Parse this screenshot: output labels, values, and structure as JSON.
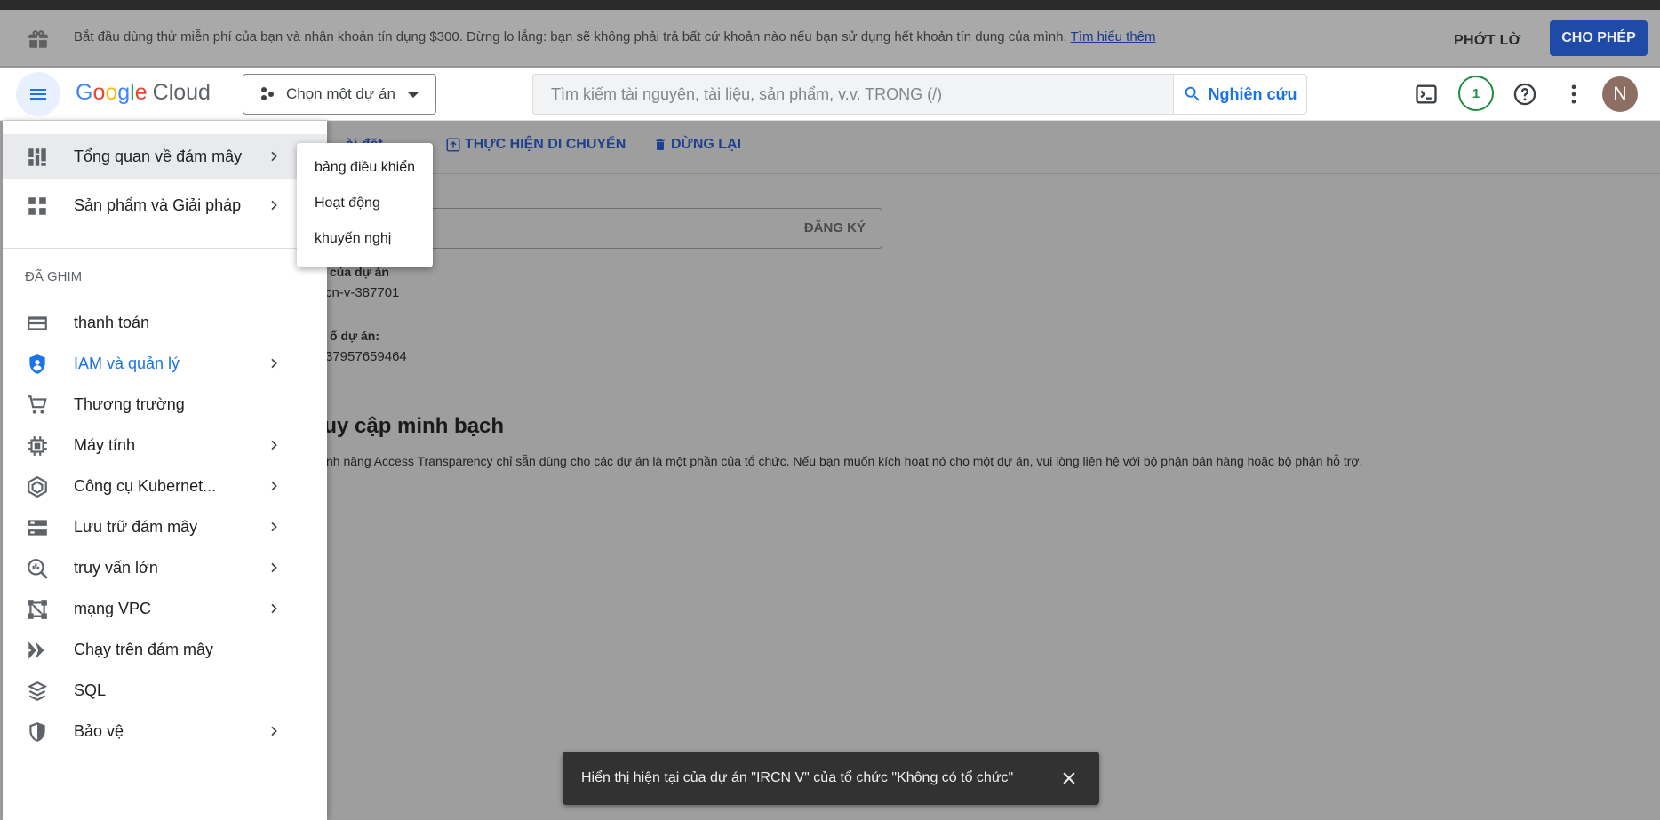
{
  "banner": {
    "message": "Bắt đầu dùng thử miễn phí của bạn và nhận khoản tín dụng $300. Đừng lo lắng: bạn sẽ không phải trả bất cứ khoản nào nếu bạn sử dụng hết khoản tín dụng của mình.",
    "learn_more": "Tìm hiểu thêm",
    "dismiss_label": "PHỚT LỜ",
    "activate_label": "CHO PHÉP"
  },
  "header": {
    "logo_google": [
      "G",
      "o",
      "o",
      "g",
      "l",
      "e"
    ],
    "logo_cloud": "Cloud",
    "project_picker": "Chọn một dự án",
    "search_placeholder": "Tìm kiếm tài nguyên, tài liệu, sản phẩm, v.v.  TRONG (/)",
    "search_button": "Nghiên cứu",
    "notification_count": "1",
    "avatar_initial": "N"
  },
  "page": {
    "toolbar_partial": "ài đặt",
    "toolbar_migrate": "THỰC HIỆN DI CHUYỂN",
    "toolbar_stop": "DỪNG LẠI",
    "register_label": "ĐĂNG KÝ",
    "project_id_label": "của dự án",
    "project_id_value": "cn-v-387701",
    "project_number_label": "ố dự án:",
    "project_number_value": "37957659464",
    "transparency_title": "ruy cập minh bạch",
    "transparency_text": "nh năng Access Transparency chỉ sẵn dùng cho các dự án là một phần của tổ chức. Nếu bạn muốn kích hoạt nó cho một dự án, vui lòng liên hệ với bộ phận bán hàng hoặc bộ phận hỗ trợ."
  },
  "sidebar": {
    "top_items": [
      {
        "label": "Tổng quan về đám mây",
        "icon": "dashboard-icon"
      },
      {
        "label": "Sản phẩm và Giải pháp",
        "icon": "apps-grid-icon"
      }
    ],
    "pinned_header": "ĐÃ GHIM",
    "pinned_items": [
      {
        "label": "thanh toán",
        "icon": "billing-icon"
      },
      {
        "label": "IAM và quản lý",
        "icon": "shield-icon"
      },
      {
        "label": "Thương trường",
        "icon": "cart-icon"
      },
      {
        "label": "Máy tính",
        "icon": "chip-icon"
      },
      {
        "label": "Công cụ Kubernet...",
        "icon": "kubernetes-icon"
      },
      {
        "label": "Lưu trữ đám mây",
        "icon": "storage-icon"
      },
      {
        "label": "truy vấn lớn",
        "icon": "bigquery-icon"
      },
      {
        "label": "mạng VPC",
        "icon": "network-icon"
      },
      {
        "label": "Chạy trên đám mây",
        "icon": "cloud-run-icon"
      },
      {
        "label": "SQL",
        "icon": "sql-icon"
      },
      {
        "label": "Bảo vệ",
        "icon": "security-icon"
      }
    ]
  },
  "flyout": {
    "items": [
      "bảng điều khiển",
      "Hoạt động",
      "khuyến nghị"
    ]
  },
  "snackbar": {
    "message": "Hiển thị hiện tại của dự án \"IRCN V\" của tổ chức \"Không có tổ chức\""
  },
  "colors": {
    "accent": "#1a73e8",
    "activate_bg": "#1f4aa8",
    "snackbar_bg": "#323232"
  }
}
